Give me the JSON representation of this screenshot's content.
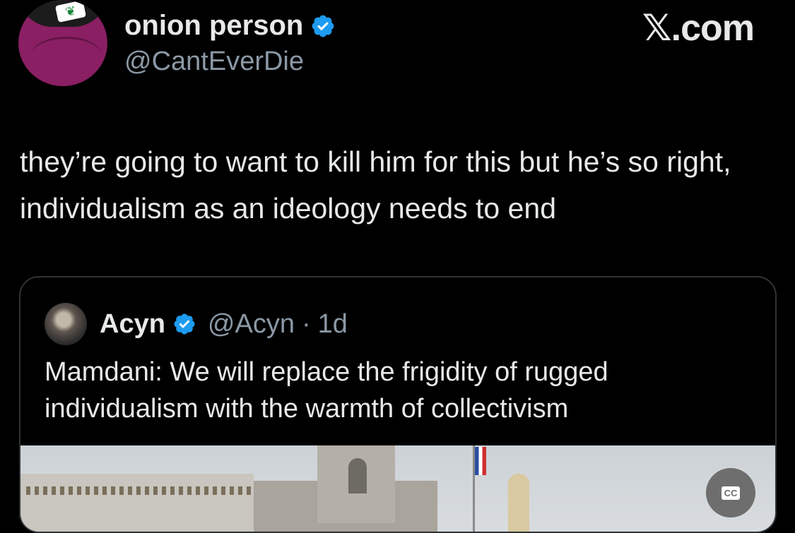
{
  "brand": {
    "watermark": "𝕏.com"
  },
  "author": {
    "display_name": "onion person",
    "handle": "@CantEverDie",
    "verified": true
  },
  "tweet": {
    "text": "they’re going to want to kill him for this but he’s so right, individualism as an ideology needs to end"
  },
  "quoted": {
    "display_name": "Acyn",
    "handle": "@Acyn",
    "separator": "·",
    "time": "1d",
    "verified": true,
    "text": "Mamdani: We will replace the frigidity of rugged individualism with the warmth of collectivism"
  },
  "media": {
    "cc_label": "CC"
  },
  "colors": {
    "background": "#000000",
    "text": "#e7e9ea",
    "muted": "#8b98a5",
    "verified_blue": "#1d9bf0",
    "border": "#2f3336"
  }
}
